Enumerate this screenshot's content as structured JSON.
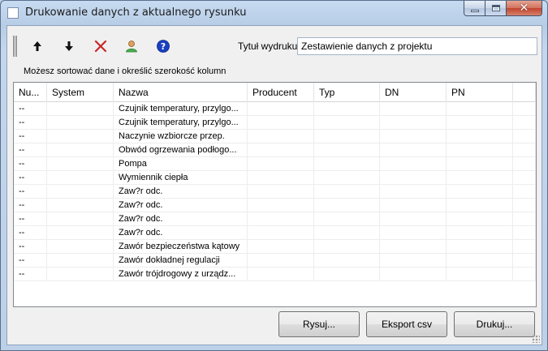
{
  "window": {
    "title": "Drukowanie danych z aktualnego rysunku",
    "icons": {
      "minimize": "minimize-icon",
      "maximize": "maximize-icon",
      "close": "close-icon"
    }
  },
  "toolbar": {
    "icons": [
      "arrow-up-icon",
      "arrow-down-icon",
      "delete-x-icon",
      "user-icon",
      "help-icon"
    ],
    "title_label": "Tytuł wydruku",
    "title_value": "Zestawienie danych z projektu"
  },
  "hint": "Możesz sortować dane i określić szerokość kolumn",
  "table": {
    "columns": [
      "Nu...",
      "System",
      "Nazwa",
      "Producent",
      "Typ",
      "DN",
      "PN",
      ""
    ],
    "rows": [
      [
        "--",
        "",
        "Czujnik temperatury, przylgo...",
        "",
        "",
        "",
        "",
        ""
      ],
      [
        "--",
        "",
        "Czujnik temperatury, przylgo...",
        "",
        "",
        "",
        "",
        ""
      ],
      [
        "--",
        "",
        "Naczynie wzbiorcze przep.",
        "",
        "",
        "",
        "",
        ""
      ],
      [
        "--",
        "",
        "Obwód ogrzewania podłogo...",
        "",
        "",
        "",
        "",
        ""
      ],
      [
        "--",
        "",
        "Pompa",
        "",
        "",
        "",
        "",
        ""
      ],
      [
        "--",
        "",
        "Wymiennik ciepła",
        "",
        "",
        "",
        "",
        ""
      ],
      [
        "--",
        "",
        "Zaw?r odc.",
        "",
        "",
        "",
        "",
        ""
      ],
      [
        "--",
        "",
        "Zaw?r odc.",
        "",
        "",
        "",
        "",
        ""
      ],
      [
        "--",
        "",
        "Zaw?r odc.",
        "",
        "",
        "",
        "",
        ""
      ],
      [
        "--",
        "",
        "Zaw?r odc.",
        "",
        "",
        "",
        "",
        ""
      ],
      [
        "--",
        "",
        "Zawór bezpieczeństwa kątowy",
        "",
        "",
        "",
        "",
        ""
      ],
      [
        "--",
        "",
        "Zawór dokładnej regulacji",
        "",
        "",
        "",
        "",
        ""
      ],
      [
        "--",
        "",
        "Zawór trójdrogowy z urządz...",
        "",
        "",
        "",
        "",
        ""
      ]
    ]
  },
  "buttons": {
    "draw": "Rysuj...",
    "export": "Eksport csv",
    "print": "Drukuj..."
  },
  "colors": {
    "accent_blue": "#1f5fbf",
    "delete_red": "#c62828",
    "help_blue": "#1a3fbf"
  }
}
